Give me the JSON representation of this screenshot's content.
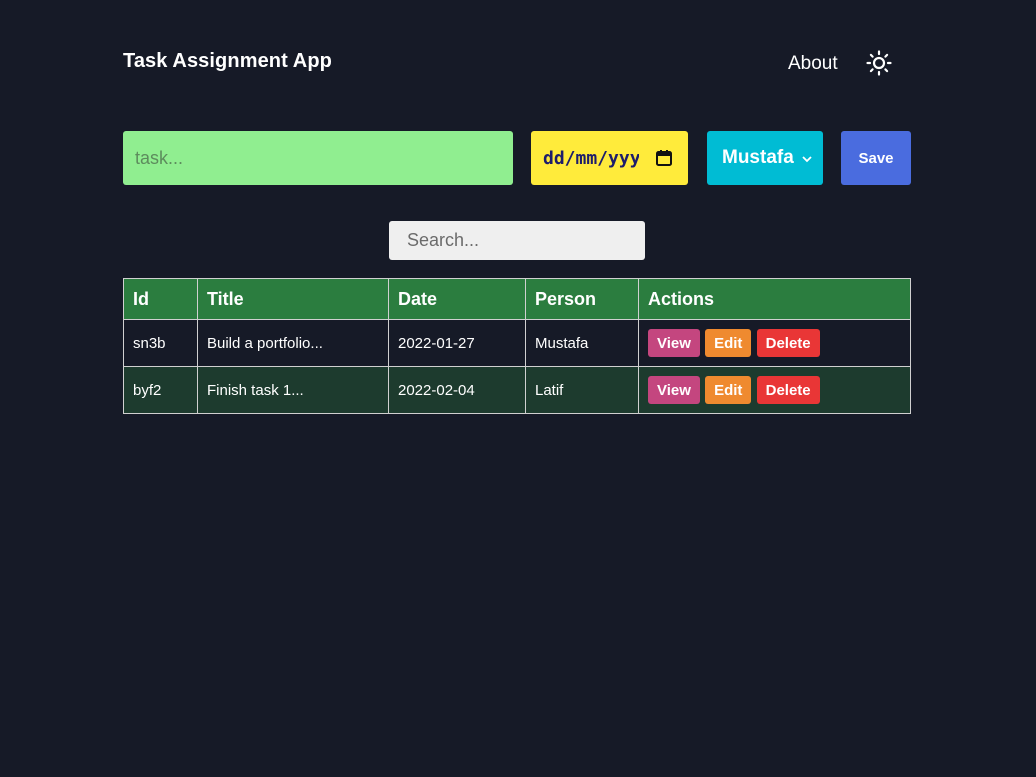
{
  "header": {
    "title": "Task Assignment App",
    "about_label": "About",
    "theme_icon": "sun-icon"
  },
  "form": {
    "task_placeholder": "task...",
    "date_value": "dd/mm/yyyy",
    "person_selected": "Mustafa",
    "save_label": "Save"
  },
  "search": {
    "placeholder": "Search..."
  },
  "table": {
    "headers": [
      "Id",
      "Title",
      "Date",
      "Person",
      "Actions"
    ],
    "rows": [
      {
        "id": "sn3b",
        "title": "Build a portfolio...",
        "date": "2022-01-27",
        "person": "Mustafa"
      },
      {
        "id": "byf2",
        "title": "Finish task 1...",
        "date": "2022-02-04",
        "person": "Latif"
      }
    ],
    "actions": {
      "view": "View",
      "edit": "Edit",
      "delete": "Delete"
    }
  },
  "colors": {
    "background": "#161a27",
    "task_input": "#90ee90",
    "date_input": "#ffeb3b",
    "person_select": "#00bcd4",
    "save_button": "#4a6cdf",
    "table_header": "#2b7d3f",
    "row_alt": "#1d3b2e",
    "view_button": "#c4467f",
    "edit_button": "#ef8a2f",
    "delete_button": "#e93636"
  }
}
